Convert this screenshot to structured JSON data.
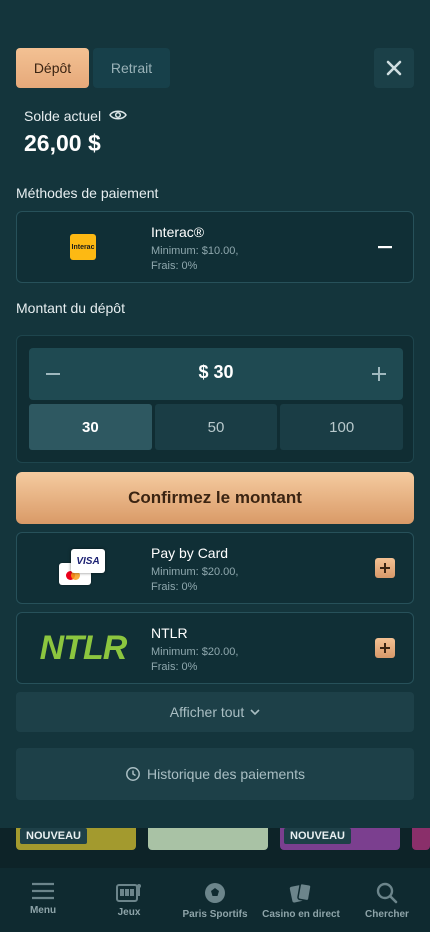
{
  "tabs": {
    "deposit": "Dépôt",
    "withdraw": "Retrait"
  },
  "balance": {
    "label": "Solde actuel",
    "value": "26,00 $"
  },
  "payment_methods_label": "Méthodes de paiement",
  "selected_method": {
    "name": "Interac®",
    "minimum": "Minimum: $10.00,",
    "fees": "Frais: 0%",
    "logo_text": "Interac"
  },
  "amount": {
    "label": "Montant du dépôt",
    "value": "$ 30",
    "presets": [
      "30",
      "50",
      "100"
    ],
    "selected_preset": "30"
  },
  "confirm_label": "Confirmez le montant",
  "other_methods": [
    {
      "name": "Pay by Card",
      "minimum": "Minimum: $20.00,",
      "fees": "Frais: 0%",
      "logo_text": "VISA"
    },
    {
      "name": "NTLR",
      "minimum": "Minimum: $20.00,",
      "fees": "Frais: 0%",
      "logo_text": "NTLR"
    }
  ],
  "show_all_label": "Afficher tout",
  "history_label": "Historique des paiements",
  "games_badges": [
    "NOUVEAU",
    "NOUVEAU"
  ],
  "nav": [
    "Menu",
    "Jeux",
    "Paris Sportifs",
    "Casino en direct",
    "Chercher"
  ],
  "colors": {
    "accent": "#e6a97a",
    "background": "#14353c",
    "ntlr_green": "#8cc63f",
    "interac_yellow": "#fdb913"
  }
}
